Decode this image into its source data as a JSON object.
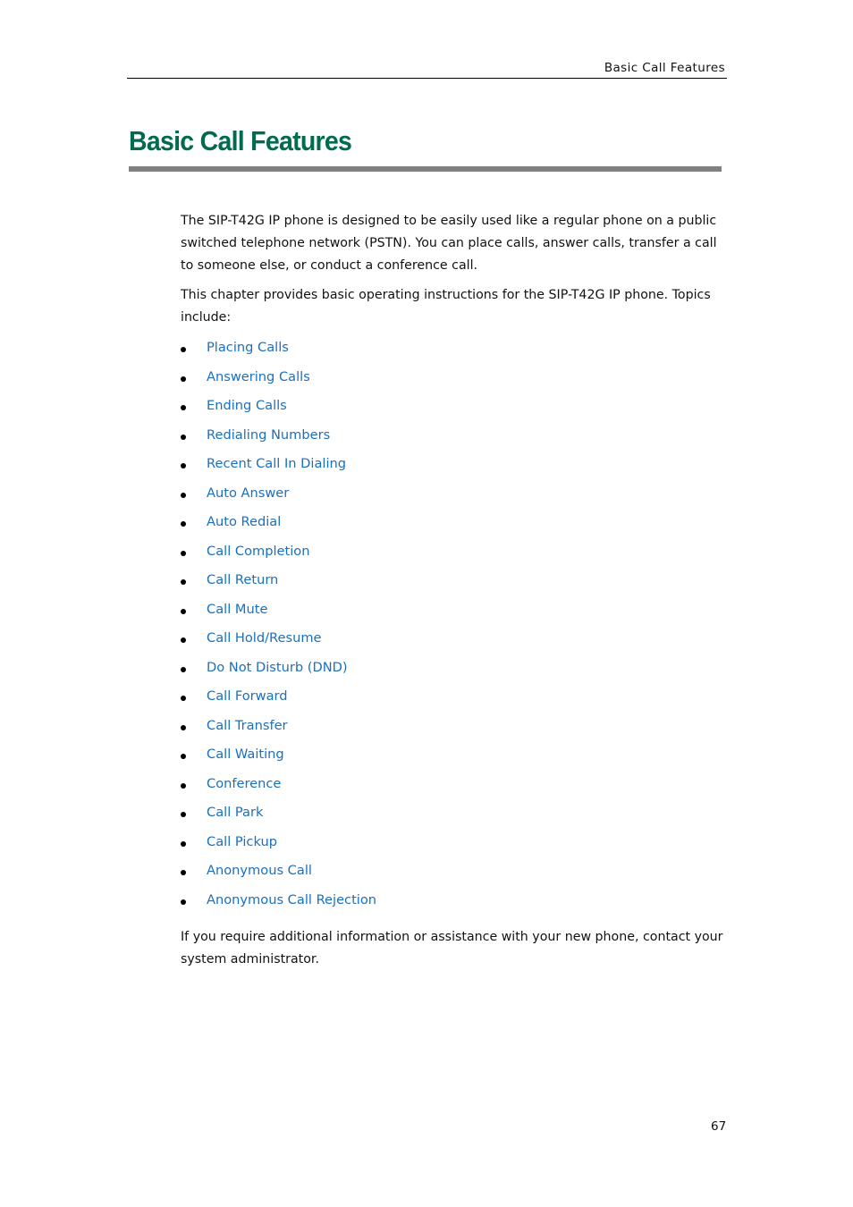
{
  "header": {
    "running_title": "Basic Call Features"
  },
  "chapter": {
    "title": "Basic Call Features"
  },
  "intro": [
    "The SIP-T42G IP phone is designed to be easily used like a regular phone on a public switched telephone network (PSTN). You can place calls, answer calls, transfer a call to someone else, or conduct a conference call.",
    "This chapter provides basic operating instructions for the SIP-T42G IP phone. Topics include:"
  ],
  "topics": [
    "Placing Calls",
    "Answering Calls",
    "Ending Calls",
    "Redialing Numbers",
    "Recent Call In Dialing",
    "Auto Answer",
    "Auto Redial",
    "Call Completion",
    "Call Return",
    "Call Mute",
    "Call Hold/Resume",
    "Do Not Disturb (DND)",
    "Call Forward",
    "Call Transfer",
    "Call Waiting",
    "Conference",
    "Call Park",
    "Call Pickup",
    "Anonymous Call",
    "Anonymous Call Rejection"
  ],
  "closing": "If you require additional information or assistance with your new phone, contact your system administrator.",
  "footer": {
    "page_number": "67"
  },
  "colors": {
    "title": "#006b4f",
    "link": "#1a6fbf",
    "rule": "#808080"
  }
}
